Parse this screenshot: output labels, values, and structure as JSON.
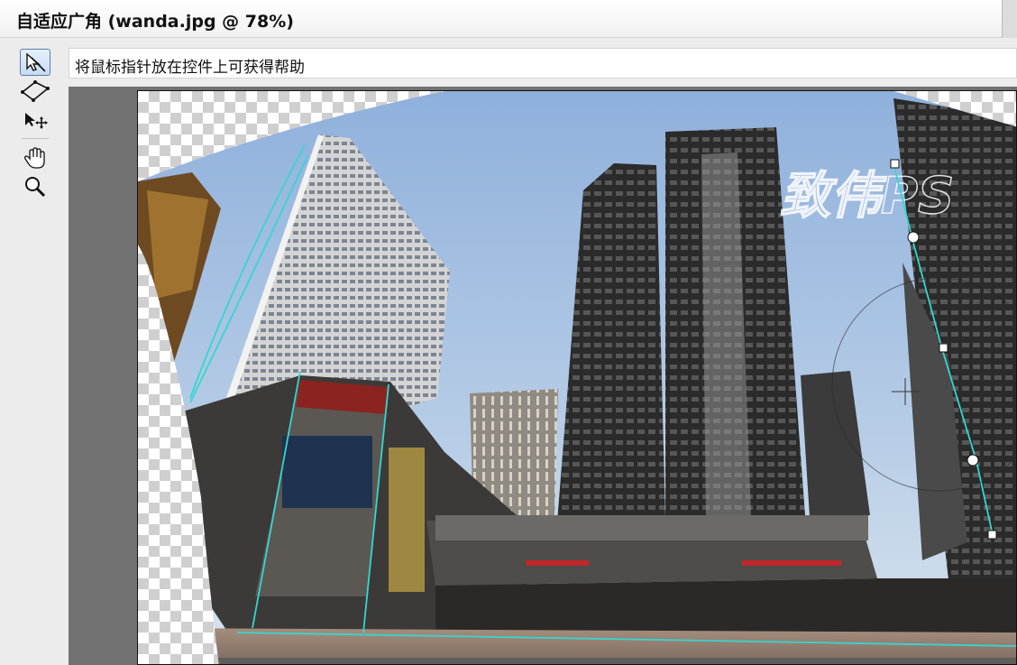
{
  "window": {
    "title": "自适应广角 (wanda.jpg @ 78%)"
  },
  "toolbar": {
    "tools": [
      {
        "name": "constraint-tool",
        "active": true
      },
      {
        "name": "polygon-constraint-tool",
        "active": false
      },
      {
        "name": "move-tool",
        "active": false
      },
      {
        "name": "hand-tool",
        "active": false
      },
      {
        "name": "zoom-tool",
        "active": false
      }
    ]
  },
  "hint": {
    "text": "将鼠标指针放在控件上可获得帮助"
  },
  "canvas": {
    "watermark": "致伟PS"
  },
  "colors": {
    "constraint_line": "#35d6d0",
    "active_tool_border": "#5a7fae",
    "sky": "#9fbde0"
  }
}
